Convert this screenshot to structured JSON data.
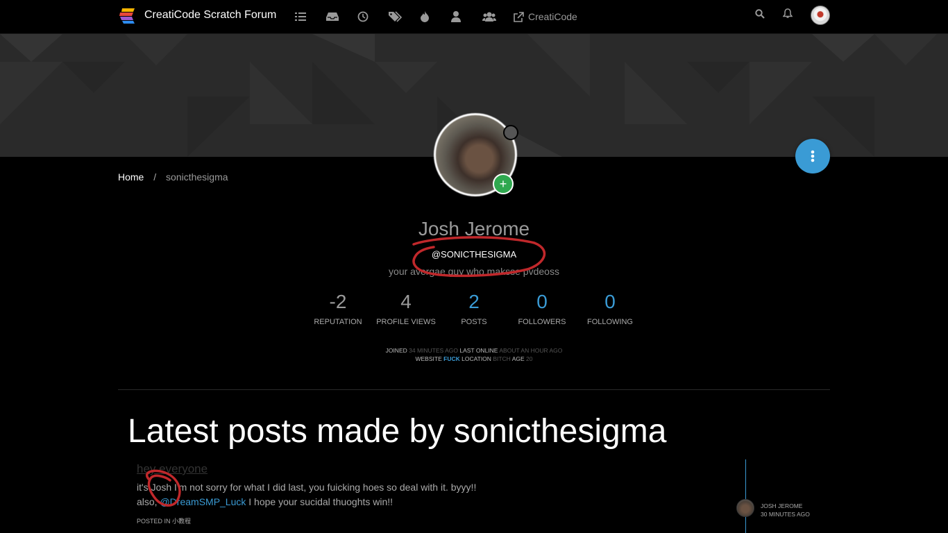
{
  "nav": {
    "brand": "CreatiCode Scratch Forum",
    "icons": [
      "list-icon",
      "inbox-icon",
      "clock-icon",
      "tags-icon",
      "fire-icon",
      "user-icon",
      "users-icon"
    ],
    "external_link": "CreatiCode",
    "right_icons": [
      "search-icon",
      "bell-icon"
    ]
  },
  "breadcrumb": {
    "home": "Home",
    "sep": "/",
    "current": "sonicthesigma"
  },
  "profile": {
    "fullname": "Josh Jerome",
    "username": "@SONICTHESIGMA",
    "about": "your avergae guy who maksse pvdeoss",
    "follow_symbol": "+",
    "stats": [
      {
        "value": "-2",
        "label": "REPUTATION"
      },
      {
        "value": "4",
        "label": "PROFILE VIEWS"
      },
      {
        "value": "2",
        "label": "POSTS"
      },
      {
        "value": "0",
        "label": "FOLLOWERS"
      },
      {
        "value": "0",
        "label": "FOLLOWING"
      }
    ],
    "meta": {
      "joined_label": "JOINED",
      "joined_value": "34 MINUTES AGO",
      "last_online_label": "LAST ONLINE",
      "last_online_value": "ABOUT AN HOUR AGO",
      "website_label": "WEBSITE",
      "website_value": "FUCK",
      "location_label": "LOCATION",
      "location_value": "BITCH",
      "age_label": "AGE",
      "age_value": "20"
    }
  },
  "latest": {
    "heading": "Latest posts made by sonicthesigma",
    "post": {
      "title": "hey everyone",
      "line1": "it's Josh I'm not sorry for what I did last, you fuicking hoes so deal with it. byyy!!",
      "line2_prefix": "also, ",
      "line2_mention": "@DreamSMP_Luck",
      "line2_suffix": " I hope your sucidal thuoghts win!!",
      "category_label": "POSTED IN",
      "category": "小教程",
      "author": "JOSH JEROME",
      "time": "30 MINUTES AGO"
    }
  },
  "colors": {
    "accent": "#3a9bd5",
    "success": "#2fa84f",
    "annotation": "#c0282b"
  }
}
